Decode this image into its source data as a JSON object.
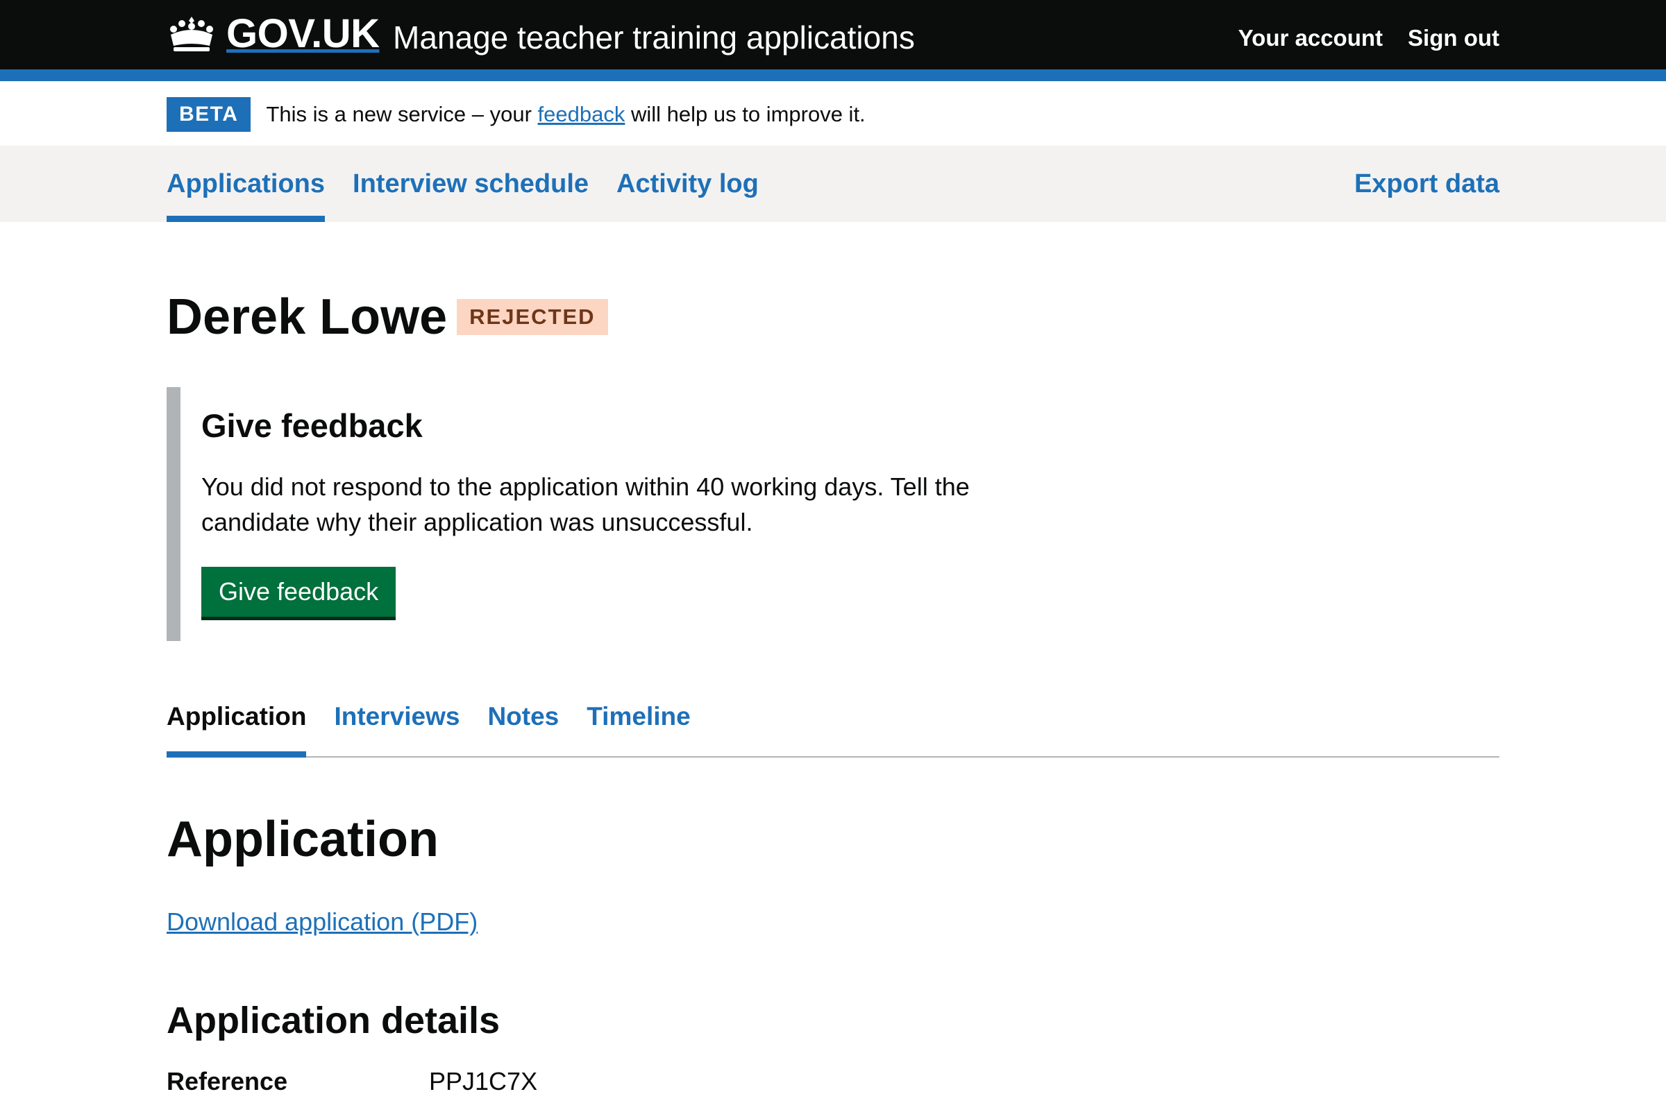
{
  "header": {
    "logo_text": "GOV.UK",
    "service_name": "Manage teacher training applications",
    "nav": {
      "account": "Your account",
      "sign_out": "Sign out"
    }
  },
  "phase_banner": {
    "tag": "BETA",
    "text_before": "This is a new service – your ",
    "link": "feedback",
    "text_after": " will help us to improve it."
  },
  "primary_nav": {
    "items": [
      "Applications",
      "Interview schedule",
      "Activity log"
    ],
    "active": "Applications",
    "export": "Export data"
  },
  "candidate": {
    "name": "Derek Lowe",
    "status": "REJECTED"
  },
  "inset": {
    "heading": "Give feedback",
    "body": "You did not respond to the application within 40 working days. Tell the candidate why their application was unsuccessful.",
    "button": "Give feedback"
  },
  "tabs": {
    "items": [
      "Application",
      "Interviews",
      "Notes",
      "Timeline"
    ],
    "active": "Application"
  },
  "section": {
    "title": "Application",
    "download": "Download application (PDF)",
    "details_title": "Application details",
    "rows": [
      {
        "key": "Reference",
        "value": "PPJ1C7X"
      }
    ]
  },
  "colors": {
    "header": "#0b0c0c",
    "brand_blue": "#1d70b8",
    "button_green": "#00703c",
    "tag_red_bg": "#fcd6c3",
    "tag_red_text": "#6e3619",
    "inset_border": "#b1b4b6",
    "nav_bg": "#f3f2f1"
  },
  "icons": [
    "crown-icon"
  ]
}
